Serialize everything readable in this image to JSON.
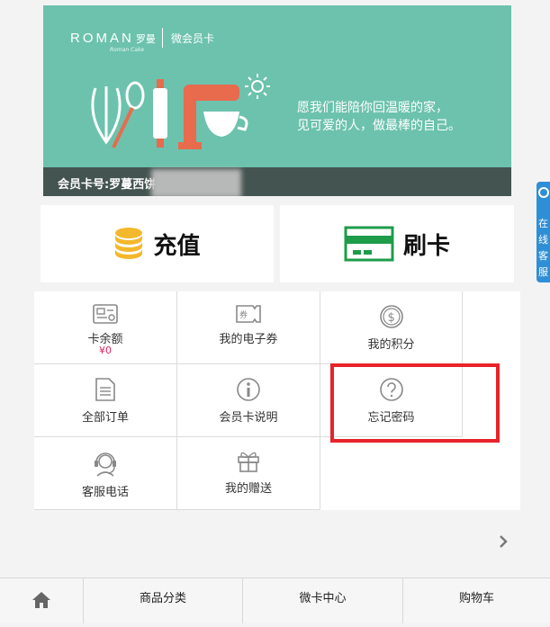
{
  "banner": {
    "brand": "ROMAN",
    "brand_cn": "罗曼",
    "brand_sub": "Roman Cake",
    "card_title": "微会员卡",
    "slogan_line1": "愿我们能陪你回温暖的家，",
    "slogan_line2": "见可爱的人，做最棒的自己。",
    "card_number": "会员卡号:罗蔓西饼"
  },
  "float_service": {
    "chars": [
      "在",
      "线",
      "客",
      "服"
    ]
  },
  "actions": {
    "recharge": "充值",
    "swipe": "刷卡"
  },
  "grid": {
    "balance": {
      "label": "卡余额",
      "value": "¥0"
    },
    "coupons": {
      "label": "我的电子券"
    },
    "points": {
      "label": "我的积分"
    },
    "orders": {
      "label": "全部订单"
    },
    "card_info": {
      "label": "会员卡说明"
    },
    "forgot_password": {
      "label": "忘记密码"
    },
    "service_phone": {
      "label": "客服电话"
    },
    "gifts": {
      "label": "我的赠送"
    }
  },
  "nav": {
    "categories": "商品分类",
    "card_center": "微卡中心",
    "cart": "购物车"
  },
  "colors": {
    "banner": "#6cc2ad",
    "accent_red": "#e8232a",
    "coin_yellow": "#f3b82b",
    "card_green": "#1e9c4a",
    "service_blue": "#2f8fd6",
    "price_pink": "#e0245e"
  }
}
